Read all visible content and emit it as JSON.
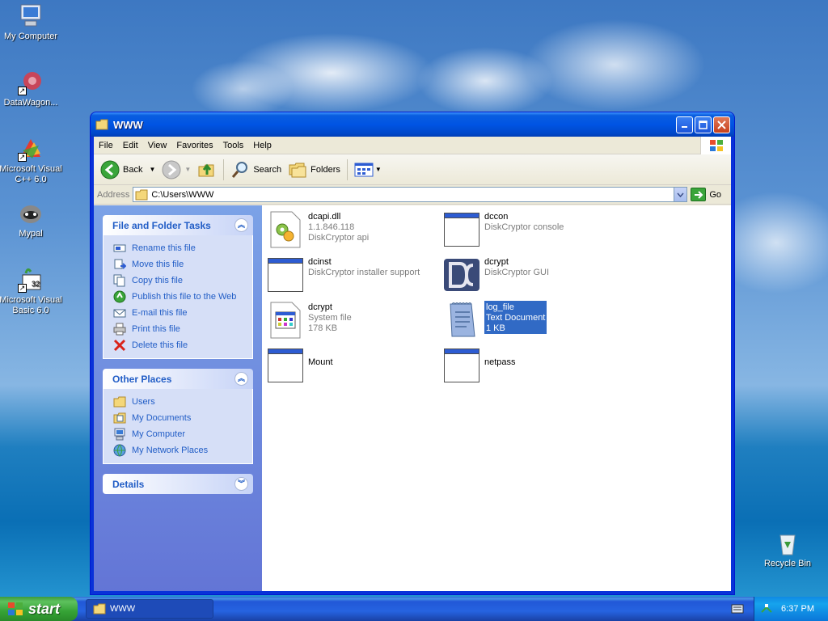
{
  "desktop": {
    "icons": [
      {
        "label": "My Computer",
        "icon": "my-computer-icon"
      },
      {
        "label": "DataWagon...",
        "icon": "datawagon-icon"
      },
      {
        "label": "Microsoft Visual C++ 6.0",
        "icon": "visual-cpp-icon"
      },
      {
        "label": "Mypal",
        "icon": "mypal-icon"
      },
      {
        "label": "Microsoft Visual Basic 6.0",
        "icon": "visual-basic-icon"
      },
      {
        "label": "Recycle Bin",
        "icon": "recycle-bin-icon"
      }
    ]
  },
  "window": {
    "title": "WWW",
    "menu": [
      "File",
      "Edit",
      "View",
      "Favorites",
      "Tools",
      "Help"
    ],
    "toolbar": {
      "back": "Back",
      "search": "Search",
      "folders": "Folders"
    },
    "address": {
      "label": "Address",
      "value": "C:\\Users\\WWW",
      "go": "Go"
    }
  },
  "taskpane": {
    "file_tasks": {
      "title": "File and Folder Tasks",
      "items": [
        "Rename this file",
        "Move this file",
        "Copy this file",
        "Publish this file to the Web",
        "E-mail this file",
        "Print this file",
        "Delete this file"
      ]
    },
    "other_places": {
      "title": "Other Places",
      "items": [
        "Users",
        "My Documents",
        "My Computer",
        "My Network Places"
      ]
    },
    "details": {
      "title": "Details"
    }
  },
  "files": [
    {
      "name": "dcapi.dll",
      "line2": "1.1.846.118",
      "line3": "DiskCryptor api",
      "icon": "dll-icon"
    },
    {
      "name": "dccon",
      "line2": "DiskCryptor console",
      "line3": "",
      "icon": "application-icon"
    },
    {
      "name": "dcinst",
      "line2": "DiskCryptor installer support",
      "line3": "",
      "icon": "application-icon"
    },
    {
      "name": "dcrypt",
      "line2": "DiskCryptor GUI",
      "line3": "",
      "icon": "diskcryptor-icon"
    },
    {
      "name": "dcrypt",
      "line2": "System file",
      "line3": "178 KB",
      "icon": "system-file-icon"
    },
    {
      "name": "log_file",
      "line2": "Text Document",
      "line3": "1 KB",
      "icon": "text-document-icon",
      "selected": true
    },
    {
      "name": "Mount",
      "line2": "",
      "line3": "",
      "icon": "application-icon"
    },
    {
      "name": "netpass",
      "line2": "",
      "line3": "",
      "icon": "application-icon"
    }
  ],
  "taskbar": {
    "start": "start",
    "task": "WWW",
    "clock": "6:37 PM"
  }
}
